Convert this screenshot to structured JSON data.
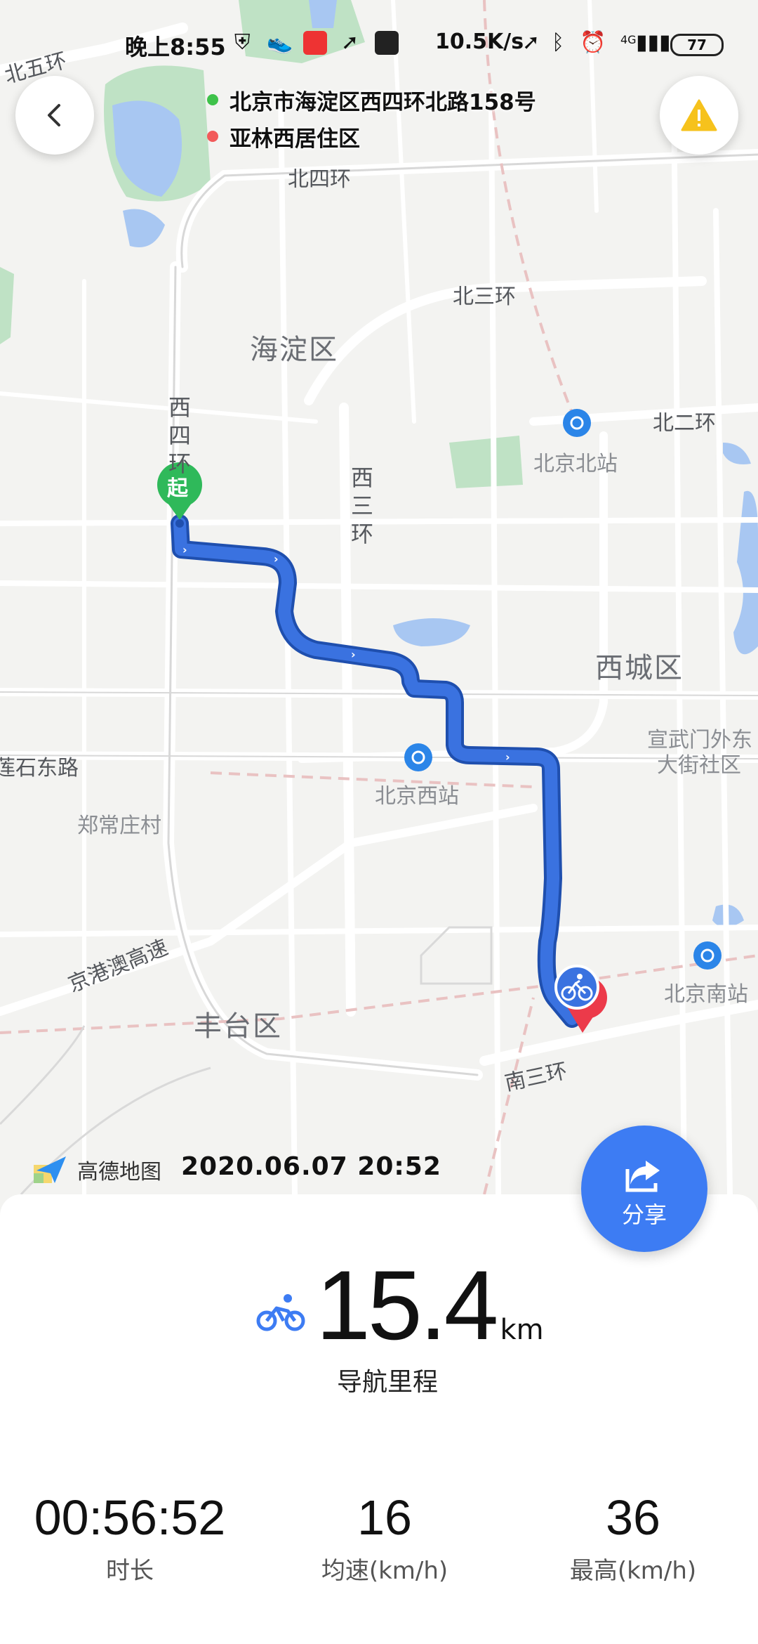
{
  "status_bar": {
    "time": "晚上8:55",
    "network_speed": "10.5K/s",
    "network_type": "4G",
    "battery": "77"
  },
  "route": {
    "start_address": "北京市海淀区西四环北路158号",
    "end_address": "亚林西居住区",
    "start_dot_color": "#3ec24a",
    "end_dot_color": "#f25a5a",
    "start_marker": "起",
    "route_color": "#3a72e0"
  },
  "map": {
    "labels": {
      "north5ring": "北五环",
      "north4ring": "北四环",
      "north3ring": "北三环",
      "north2ring": "北二环",
      "haidian": "海淀区",
      "west4ring": "西四环",
      "west3ring": "西三环",
      "beijing_north_station": "北京北站",
      "xicheng": "西城区",
      "xuanwumen": "宣武门外东",
      "xuanwumen2": "大街社区",
      "lianshi_road": "莲石东路",
      "beijing_west_station": "北京西站",
      "zhengchang": "郑常庄村",
      "jinggangao": "京港澳高速",
      "fengtai": "丰台区",
      "beijing_south_station": "北京南站",
      "south3ring": "南三环"
    },
    "brand": "高德地图",
    "datetime": "2020.06.07 20:52"
  },
  "share_button": {
    "label": "分享"
  },
  "summary": {
    "distance": "15.4",
    "distance_unit": "km",
    "distance_label": "导航里程",
    "stats": [
      {
        "value": "00:56:52",
        "label": "时长"
      },
      {
        "value": "16",
        "label": "均速(km/h)"
      },
      {
        "value": "36",
        "label": "最高(km/h)"
      }
    ]
  },
  "icons": {
    "back": "chevron-left-icon",
    "warning": "warning-icon",
    "share": "share-icon",
    "cycling": "bicycle-icon"
  }
}
